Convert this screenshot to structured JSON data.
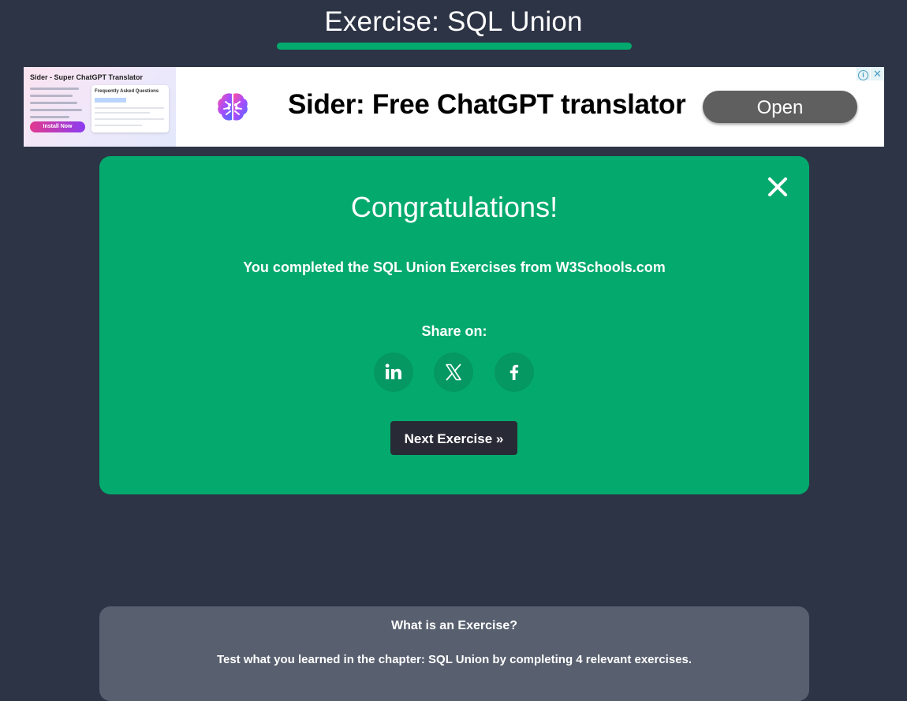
{
  "header": {
    "title": "Exercise: SQL Union"
  },
  "ad": {
    "thumb_title": "Sider - Super ChatGPT Translator",
    "thumb_install_label": "Install Now",
    "thumb_card_title": "Frequently Asked Questions",
    "headline": "Sider: Free ChatGPT translator",
    "open_label": "Open",
    "info_label": "i",
    "close_label": "✕"
  },
  "congrats": {
    "heading": "Congratulations!",
    "message": "You completed the SQL Union Exercises from W3Schools.com",
    "share_label": "Share on:",
    "next_label": "Next Exercise »"
  },
  "info": {
    "heading": "What is an Exercise?",
    "text": "Test what you learned in the chapter: SQL Union by completing 4 relevant exercises."
  },
  "colors": {
    "background": "#2d3446",
    "accent": "#04aa6d",
    "share_button": "#059862",
    "next_button": "#282a35",
    "info_panel": "#585f6f"
  },
  "icons": {
    "share": [
      "linkedin-icon",
      "x-icon",
      "facebook-icon"
    ],
    "close": "close-icon",
    "ad_logo": "brain-icon"
  }
}
